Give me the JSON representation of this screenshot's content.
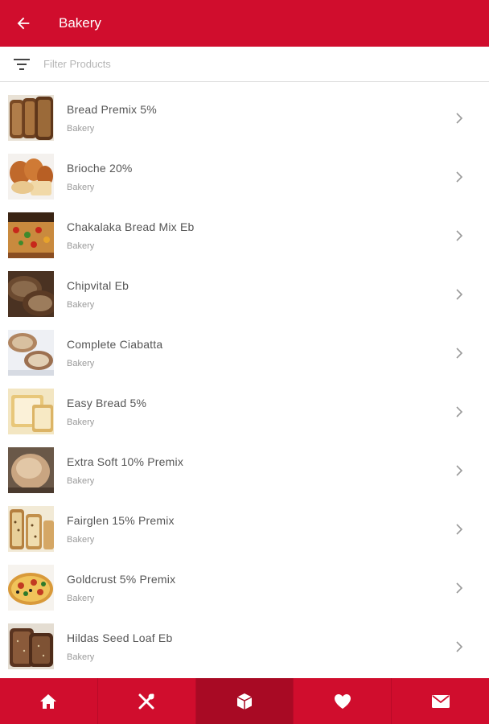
{
  "header": {
    "title": "Bakery",
    "back_icon": "arrow-left-icon",
    "background": "#d00d2d"
  },
  "filter": {
    "icon": "filter-icon",
    "placeholder": "Filter Products"
  },
  "products": [
    {
      "name": "Bread Premix 5%",
      "category": "Bakery",
      "image": "sliced-brown-bread"
    },
    {
      "name": "Brioche 20%",
      "category": "Bakery",
      "image": "brioche-loaf"
    },
    {
      "name": "Chakalaka Bread Mix Eb",
      "category": "Bakery",
      "image": "chakalaka-bread"
    },
    {
      "name": "Chipvital Eb",
      "category": "Bakery",
      "image": "rustic-loaf"
    },
    {
      "name": "Complete Ciabatta",
      "category": "Bakery",
      "image": "ciabatta"
    },
    {
      "name": "Easy Bread 5%",
      "category": "Bakery",
      "image": "white-bread"
    },
    {
      "name": "Extra Soft 10% Premix",
      "category": "Bakery",
      "image": "round-bun"
    },
    {
      "name": "Fairglen 15% Premix",
      "category": "Bakery",
      "image": "seeded-bread"
    },
    {
      "name": "Goldcrust 5% Premix",
      "category": "Bakery",
      "image": "pizza"
    },
    {
      "name": "Hildas Seed Loaf Eb",
      "category": "Bakery",
      "image": "seed-loaf"
    }
  ],
  "bottom_nav": [
    {
      "icon": "home-icon",
      "active": false
    },
    {
      "icon": "utensils-icon",
      "active": false
    },
    {
      "icon": "box-icon",
      "active": true
    },
    {
      "icon": "heart-icon",
      "active": false
    },
    {
      "icon": "mail-icon",
      "active": false
    }
  ],
  "colors": {
    "accent": "#d00d2d",
    "active_tab": "#a80a24",
    "title_text": "#555555",
    "subtitle_text": "#9a9a9a"
  }
}
